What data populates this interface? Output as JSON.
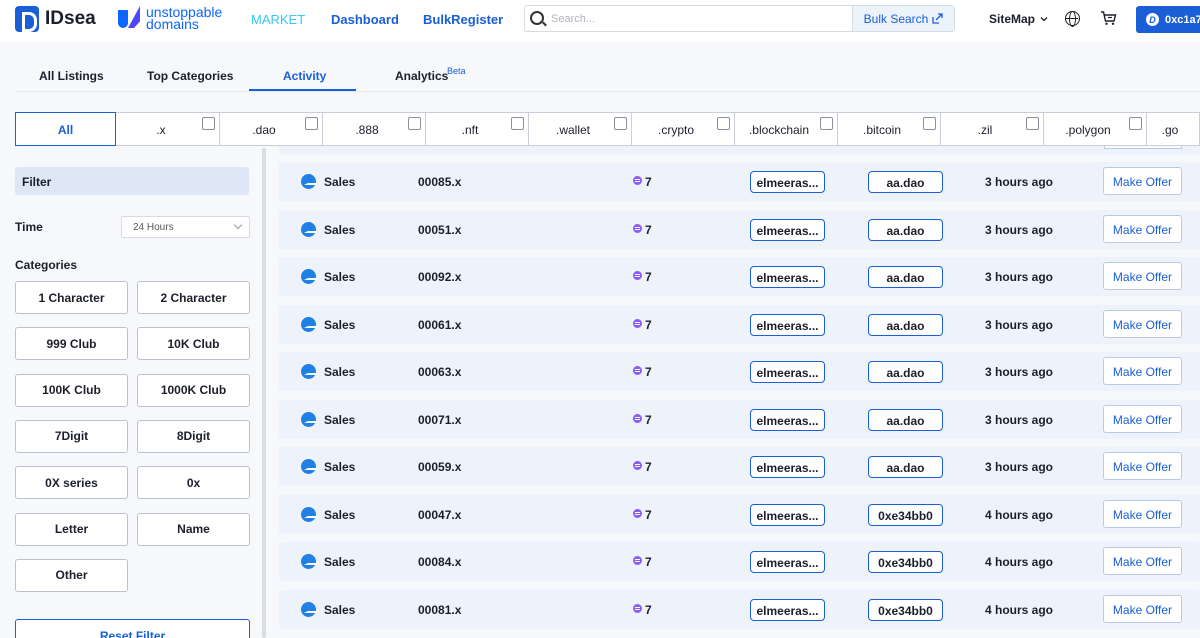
{
  "header": {
    "brand": "IDsea",
    "partner": "unstoppable domains",
    "nav": {
      "market": "MARKET",
      "dashboard": "Dashboard",
      "bulk_register": "BulkRegister"
    },
    "search": {
      "placeholder": "Search...",
      "bulk_search_label": "Bulk Search"
    },
    "sitemap": "SiteMap",
    "wallet": "0xc1a7"
  },
  "tabs": {
    "all_listings": "All Listings",
    "top_categories": "Top Categories",
    "activity": "Activity",
    "analytics": "Analytics",
    "beta": "Beta",
    "active": "Activity"
  },
  "tlds": [
    ".x",
    ".dao",
    ".888",
    ".nft",
    ".wallet",
    ".crypto",
    ".blockchain",
    ".bitcoin",
    ".zil",
    ".polygon",
    ".go"
  ],
  "tld_all": "All",
  "sidebar": {
    "filter": "Filter",
    "time_label": "Time",
    "time_value": "24 Hours",
    "categories_label": "Categories",
    "categories": [
      "1 Character",
      "2 Character",
      "999 Club",
      "10K Club",
      "100K Club",
      "1000K Club",
      "7Digit",
      "8Digit",
      "0X series",
      "0x",
      "Letter",
      "Name",
      "Other"
    ],
    "reset": "Reset Filter"
  },
  "rows": [
    {
      "type": "Sales",
      "domain": "00085.x",
      "price": "7",
      "from": "elmeeras...",
      "to": "aa.dao",
      "time": "3 hours ago",
      "action": "Make Offer"
    },
    {
      "type": "Sales",
      "domain": "00051.x",
      "price": "7",
      "from": "elmeeras...",
      "to": "aa.dao",
      "time": "3 hours ago",
      "action": "Make Offer"
    },
    {
      "type": "Sales",
      "domain": "00092.x",
      "price": "7",
      "from": "elmeeras...",
      "to": "aa.dao",
      "time": "3 hours ago",
      "action": "Make Offer"
    },
    {
      "type": "Sales",
      "domain": "00061.x",
      "price": "7",
      "from": "elmeeras...",
      "to": "aa.dao",
      "time": "3 hours ago",
      "action": "Make Offer"
    },
    {
      "type": "Sales",
      "domain": "00063.x",
      "price": "7",
      "from": "elmeeras...",
      "to": "aa.dao",
      "time": "3 hours ago",
      "action": "Make Offer"
    },
    {
      "type": "Sales",
      "domain": "00071.x",
      "price": "7",
      "from": "elmeeras...",
      "to": "aa.dao",
      "time": "3 hours ago",
      "action": "Make Offer"
    },
    {
      "type": "Sales",
      "domain": "00059.x",
      "price": "7",
      "from": "elmeeras...",
      "to": "aa.dao",
      "time": "3 hours ago",
      "action": "Make Offer"
    },
    {
      "type": "Sales",
      "domain": "00047.x",
      "price": "7",
      "from": "elmeeras...",
      "to": "0xe34bb0",
      "time": "4 hours ago",
      "action": "Make Offer"
    },
    {
      "type": "Sales",
      "domain": "00084.x",
      "price": "7",
      "from": "elmeeras...",
      "to": "0xe34bb0",
      "time": "4 hours ago",
      "action": "Make Offer"
    },
    {
      "type": "Sales",
      "domain": "00081.x",
      "price": "7",
      "from": "elmeeras...",
      "to": "0xe34bb0",
      "time": "4 hours ago",
      "action": "Make Offer"
    }
  ],
  "colors": {
    "primary": "#1a5fd6",
    "market": "#38c7f3",
    "row_bg": "#eef3fb",
    "page_bg": "#f6f8fb",
    "opensea": "#2081e2",
    "eth": "#8b5cf6"
  },
  "icons": {
    "search": "search-icon",
    "external": "external-link-icon",
    "chevron": "chevron-down-icon",
    "globe": "globe-icon",
    "cart": "cart-icon",
    "wallet": "wallet-icon",
    "marketplace": "opensea-icon",
    "currency": "eth-icon"
  }
}
